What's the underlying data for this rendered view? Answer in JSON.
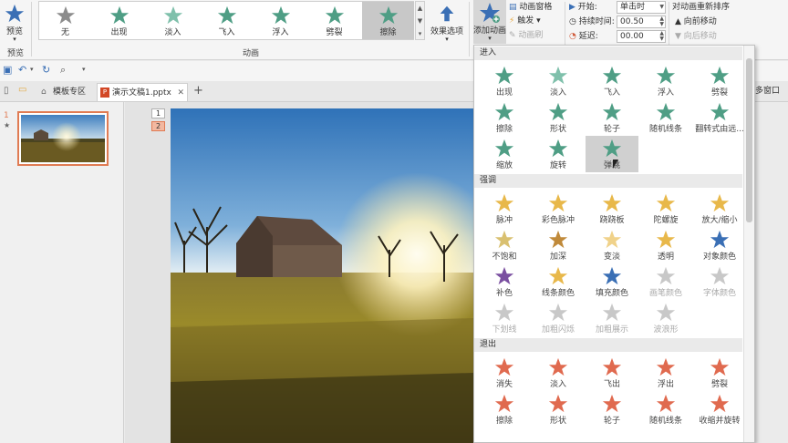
{
  "ribbon": {
    "preview_label": "预览",
    "preview_group": "预览",
    "animation_group": "动画",
    "gallery": [
      {
        "label": "无",
        "color": "#8c8c8c"
      },
      {
        "label": "出现",
        "color": "#4f9e85"
      },
      {
        "label": "淡入",
        "color": "#7fc0ab"
      },
      {
        "label": "飞入",
        "color": "#4f9e85"
      },
      {
        "label": "浮入",
        "color": "#4f9e85"
      },
      {
        "label": "劈裂",
        "color": "#4f9e85"
      },
      {
        "label": "擦除",
        "color": "#4f9e85",
        "selected": true
      }
    ],
    "effect_options": "效果选项",
    "add_animation": "添加动画",
    "animation_pane": "动画窗格",
    "trigger": "触发",
    "animation_painter": "动画刷",
    "start_label": "开始:",
    "start_value": "单击时",
    "duration_label": "持续时间:",
    "duration_value": "00.50",
    "delay_label": "延迟:",
    "delay_value": "00.00",
    "reorder_title": "对动画重新排序",
    "move_earlier": "向前移动",
    "move_later": "向后移动"
  },
  "tabs": {
    "template_zone": "模板专区",
    "document": "演示文稿1.pptx",
    "multi_window": "多窗口"
  },
  "slides": {
    "slide_number": "1",
    "star_marker": "★",
    "anim_badges": [
      "1",
      "2"
    ]
  },
  "dropdown": {
    "sections": [
      {
        "title": "进入",
        "items": [
          {
            "label": "出现",
            "color": "#4f9e85"
          },
          {
            "label": "淡入",
            "color": "#7fc0ab"
          },
          {
            "label": "飞入",
            "color": "#4f9e85"
          },
          {
            "label": "浮入",
            "color": "#4f9e85"
          },
          {
            "label": "劈裂",
            "color": "#4f9e85"
          },
          {
            "label": "擦除",
            "color": "#4f9e85"
          },
          {
            "label": "形状",
            "color": "#4f9e85"
          },
          {
            "label": "轮子",
            "color": "#4f9e85"
          },
          {
            "label": "随机线条",
            "color": "#4f9e85"
          },
          {
            "label": "翻转式由远...",
            "color": "#4f9e85"
          },
          {
            "label": "缩放",
            "color": "#4f9e85"
          },
          {
            "label": "旋转",
            "color": "#4f9e85"
          },
          {
            "label": "弹跳",
            "color": "#4f9e85",
            "hover": true
          }
        ]
      },
      {
        "title": "强调",
        "items": [
          {
            "label": "脉冲",
            "color": "#e8b84a"
          },
          {
            "label": "彩色脉冲",
            "color": "#e8b84a"
          },
          {
            "label": "跷跷板",
            "color": "#e8b84a"
          },
          {
            "label": "陀螺旋",
            "color": "#e8b84a"
          },
          {
            "label": "放大/缩小",
            "color": "#e8b84a"
          },
          {
            "label": "不饱和",
            "color": "#d9c070"
          },
          {
            "label": "加深",
            "color": "#c08a3a"
          },
          {
            "label": "变淡",
            "color": "#f0d28a"
          },
          {
            "label": "透明",
            "color": "#e8b84a"
          },
          {
            "label": "对象颜色",
            "color": "#3a6fb5"
          },
          {
            "label": "补色",
            "color": "#7a4fa0"
          },
          {
            "label": "线条颜色",
            "color": "#e8b84a"
          },
          {
            "label": "填充颜色",
            "color": "#3a6fb5"
          },
          {
            "label": "画笔颜色",
            "color": "#c8c8c8",
            "disabled": true
          },
          {
            "label": "字体颜色",
            "color": "#c8c8c8",
            "disabled": true
          },
          {
            "label": "下划线",
            "color": "#c8c8c8",
            "disabled": true
          },
          {
            "label": "加粗闪烁",
            "color": "#c8c8c8",
            "disabled": true
          },
          {
            "label": "加粗展示",
            "color": "#c8c8c8",
            "disabled": true
          },
          {
            "label": "波浪形",
            "color": "#c8c8c8",
            "disabled": true
          }
        ]
      },
      {
        "title": "退出",
        "items": [
          {
            "label": "消失",
            "color": "#e06a4f"
          },
          {
            "label": "淡入",
            "color": "#e06a4f"
          },
          {
            "label": "飞出",
            "color": "#e06a4f"
          },
          {
            "label": "浮出",
            "color": "#e06a4f"
          },
          {
            "label": "劈裂",
            "color": "#e06a4f"
          },
          {
            "label": "擦除",
            "color": "#e06a4f"
          },
          {
            "label": "形状",
            "color": "#e06a4f"
          },
          {
            "label": "轮子",
            "color": "#e06a4f"
          },
          {
            "label": "随机线条",
            "color": "#e06a4f"
          },
          {
            "label": "收缩并旋转",
            "color": "#e06a4f"
          }
        ]
      }
    ]
  },
  "colors": {
    "accent": "#e07b53",
    "enter": "#4f9e85",
    "emphasis": "#e8b84a",
    "exit": "#e06a4f"
  }
}
